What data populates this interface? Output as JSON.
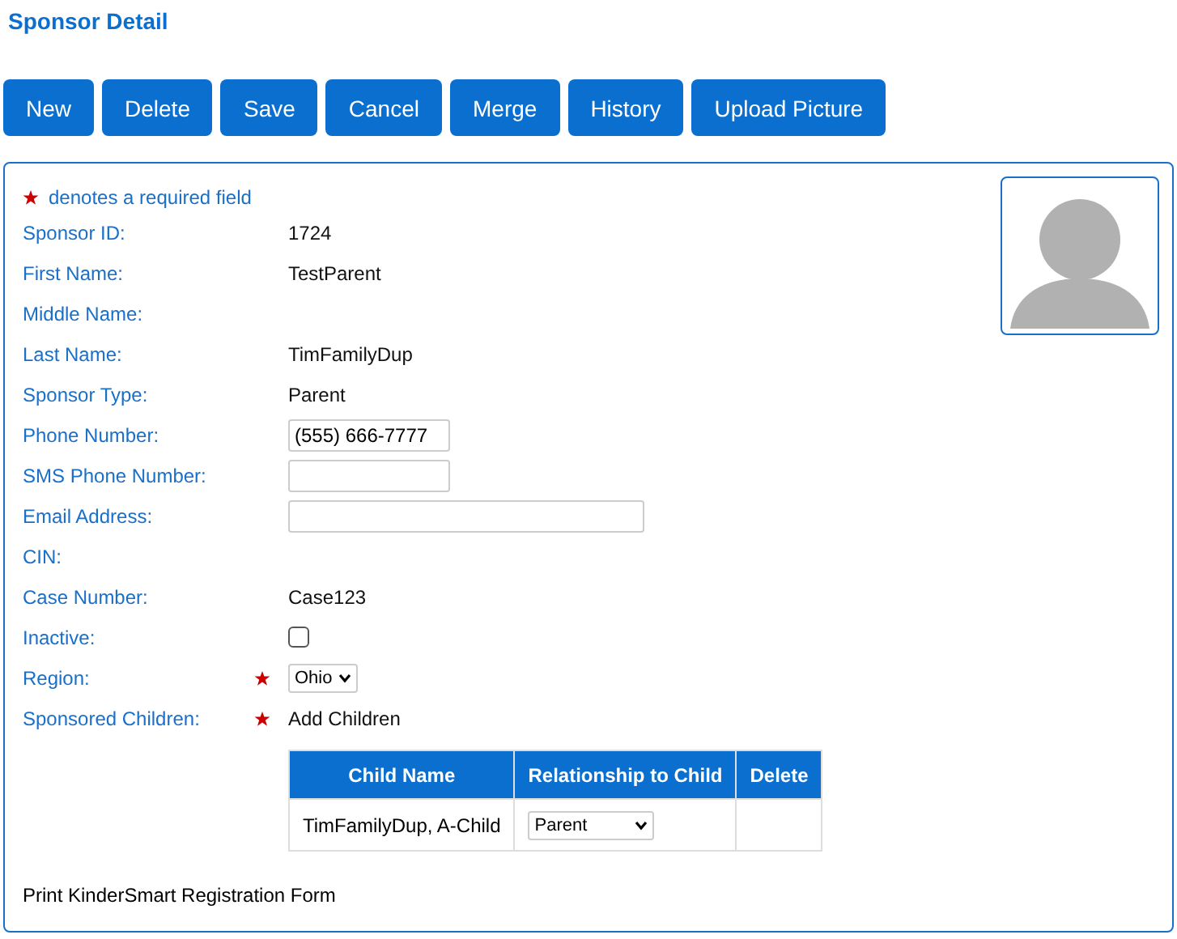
{
  "title": "Sponsor Detail",
  "buttons": [
    "New",
    "Delete",
    "Save",
    "Cancel",
    "Merge",
    "History",
    "Upload Picture"
  ],
  "required_note": "denotes a required field",
  "fields": [
    {
      "label": "Sponsor ID:",
      "kind": "text",
      "value": "1724",
      "required": false
    },
    {
      "label": "First Name:",
      "kind": "text",
      "value": "TestParent",
      "required": false
    },
    {
      "label": "Middle Name:",
      "kind": "text",
      "required": false
    },
    {
      "label": "Last Name:",
      "kind": "text",
      "value": "TimFamilyDup",
      "required": false
    },
    {
      "label": "Sponsor Type:",
      "kind": "text",
      "value": "Parent",
      "required": false
    },
    {
      "label": "Phone Number:",
      "kind": "input",
      "value": "(555) 666-7777",
      "required": false
    },
    {
      "label": "SMS Phone Number:",
      "kind": "input",
      "required": false
    },
    {
      "label": "Email Address:",
      "kind": "wide-input",
      "required": false
    },
    {
      "label": "CIN:",
      "kind": "text",
      "required": false
    },
    {
      "label": "Case Number:",
      "kind": "text",
      "value": "Case123",
      "required": false
    },
    {
      "label": "Inactive:",
      "kind": "checkbox",
      "checked": false,
      "required": false
    },
    {
      "label": "Region:",
      "kind": "select",
      "value": "Ohio",
      "required": true
    },
    {
      "label": "Sponsored Children:",
      "kind": "text",
      "value": "Add Children",
      "required": true
    }
  ],
  "children_table": {
    "columns": [
      "Child Name",
      "Relationship to Child",
      "Delete"
    ],
    "rows": [
      {
        "child_name": "TimFamilyDup, A-Child",
        "relationship": "Parent"
      }
    ]
  },
  "footer_link": "Print KinderSmart Registration Form"
}
